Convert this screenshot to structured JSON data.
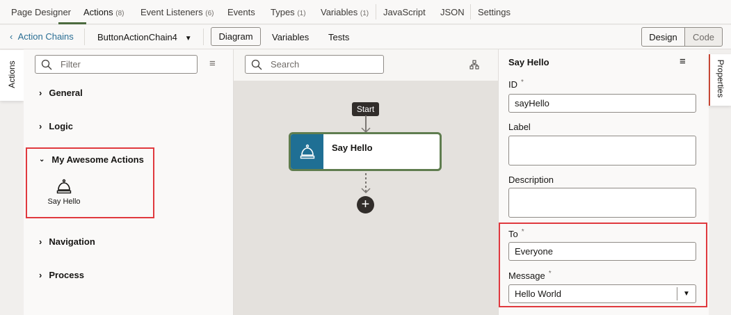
{
  "top_tabs": [
    {
      "label": "Page Designer",
      "count": ""
    },
    {
      "label": "Actions",
      "count": "(8)"
    },
    {
      "label": "Event Listeners",
      "count": "(6)"
    },
    {
      "label": "Events",
      "count": ""
    },
    {
      "label": "Types",
      "count": "(1)"
    },
    {
      "label": "Variables",
      "count": "(1)"
    },
    {
      "label": "JavaScript",
      "count": ""
    },
    {
      "label": "JSON",
      "count": ""
    },
    {
      "label": "Settings",
      "count": ""
    }
  ],
  "subbar": {
    "back": "Action Chains",
    "chain": "ButtonActionChain4",
    "tabs": [
      "Diagram",
      "Variables",
      "Tests"
    ],
    "design": "Design",
    "code": "Code"
  },
  "left": {
    "vtab": "Actions",
    "filter_placeholder": "Filter",
    "groups": [
      "General",
      "Logic",
      "My Awesome Actions",
      "Navigation",
      "Process"
    ],
    "item": "Say Hello"
  },
  "canvas": {
    "search_placeholder": "Search",
    "start": "Start",
    "node": "Say Hello"
  },
  "right": {
    "title": "Say Hello",
    "vtab": "Properties",
    "id_label": "ID",
    "id_value": "sayHello",
    "label_label": "Label",
    "label_value": "",
    "desc_label": "Description",
    "desc_value": "",
    "to_label": "To",
    "to_value": "Everyone",
    "msg_label": "Message",
    "msg_value": "Hello World",
    "required": "*"
  }
}
